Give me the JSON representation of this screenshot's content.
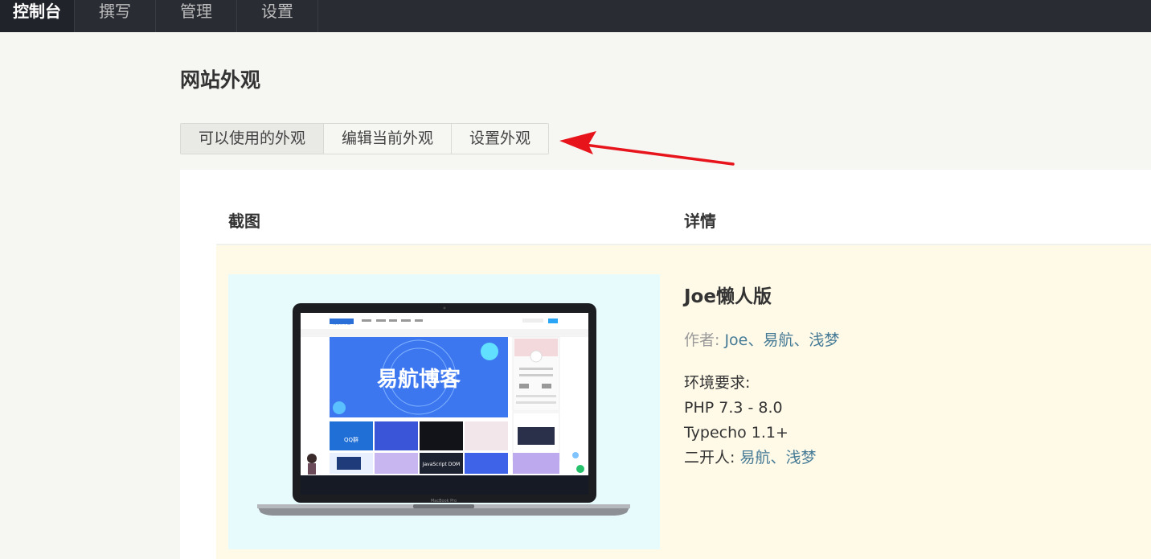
{
  "nav": {
    "items": [
      "控制台",
      "撰写",
      "管理",
      "设置"
    ]
  },
  "page": {
    "title": "网站外观"
  },
  "tabs": [
    "可以使用的外观",
    "编辑当前外观",
    "设置外观"
  ],
  "table": {
    "headers": [
      "截图",
      "详情"
    ]
  },
  "theme": {
    "name": "Joe懒人版",
    "author_label": "作者: ",
    "authors": [
      "Joe",
      "易航",
      "浅梦"
    ],
    "author_sep": "、",
    "requirements_label": "环境要求:",
    "requirements": [
      "PHP 7.3 - 8.0",
      "Typecho 1.1+"
    ],
    "secondary_label": "二开人: ",
    "secondary_authors": [
      "易航",
      "浅梦"
    ],
    "screenshot": {
      "banner_text": "易航博客",
      "site_logo": "易航博客",
      "device_label": "MacBook Pro",
      "tile_texts": [
        "QQ群",
        "JavaScript DOM"
      ]
    }
  },
  "colors": {
    "topbar": "#292d33",
    "link": "#467b96",
    "arrow": "#e8141b",
    "row_highlight": "#fff9e8"
  }
}
